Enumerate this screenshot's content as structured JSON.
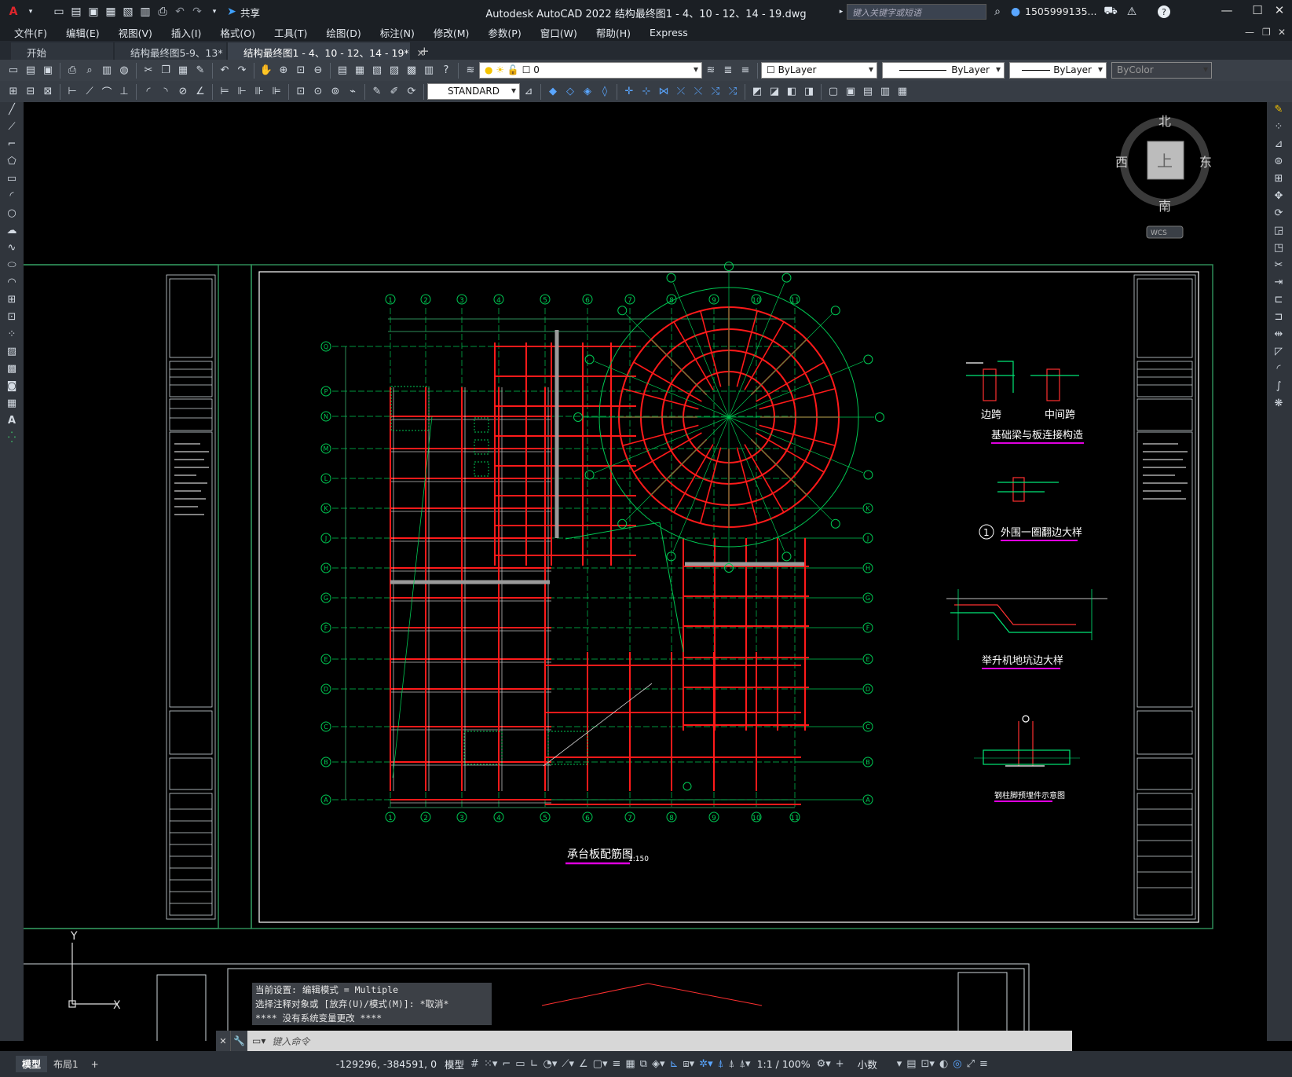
{
  "titlebar": {
    "app_logo": "A",
    "share_label": "共享",
    "title": "Autodesk AutoCAD 2022    结构最终图1 - 4、10 - 12、14 - 19.dwg",
    "search_placeholder": "键入关键字或短语",
    "user": "1505999135...",
    "help": "?"
  },
  "menu": [
    "文件(F)",
    "编辑(E)",
    "视图(V)",
    "插入(I)",
    "格式(O)",
    "工具(T)",
    "绘图(D)",
    "标注(N)",
    "修改(M)",
    "参数(P)",
    "窗口(W)",
    "帮助(H)",
    "Express"
  ],
  "tabs": [
    {
      "label": "开始",
      "closable": false,
      "active": false
    },
    {
      "label": "结构最终图5-9、13*",
      "closable": true,
      "active": false
    },
    {
      "label": "结构最终图1 - 4、10 - 12、14 - 19*",
      "closable": true,
      "active": true
    }
  ],
  "tab_close": "✕",
  "tab_add": "+",
  "toolbar": {
    "layer_value": "0",
    "color_value": "ByLayer",
    "linetype_value": "ByLayer",
    "lineweight_value": "ByLayer",
    "plotstyle_value": "ByColor",
    "textstyle_value": "STANDARD"
  },
  "viewcube": {
    "north": "北",
    "south": "南",
    "east": "东",
    "west": "西",
    "top": "上",
    "wcs": "WCS"
  },
  "drawing": {
    "main_title": "承台板配筋图",
    "scale": "1:150",
    "detail1_left": "边跨",
    "detail1_right": "中间跨",
    "detail1_title": "基础梁与板连接构造",
    "detail2_num": "1",
    "detail2_title": "外围一圈翻边大样",
    "detail3_title": "举升机地坑边大样",
    "detail4_title": "钢柱脚预埋件示意图",
    "grid_rows": [
      "Q",
      "P",
      "N",
      "M",
      "L",
      "K",
      "J",
      "H",
      "G",
      "F",
      "E",
      "D",
      "C",
      "B",
      "A"
    ],
    "grid_cols": [
      "1",
      "2",
      "3",
      "4",
      "5",
      "6",
      "7",
      "8",
      "9",
      "10",
      "11"
    ]
  },
  "ucs": {
    "y": "Y",
    "x": "X"
  },
  "command": {
    "history": [
      "当前设置: 编辑模式 = Multiple",
      "选择注释对象或 [放弃(U)/模式(M)]: *取消*",
      "**** 没有系统变量更改 ****"
    ],
    "placeholder": "键入命令"
  },
  "status": {
    "layout_tabs": [
      "模型",
      "布局1"
    ],
    "add": "+",
    "coords": "-129296, -384591, 0",
    "model": "模型",
    "scale": "1:1 / 100%",
    "units": "小数"
  },
  "colors": {
    "grid": "#00c853",
    "beam": "#ff1a1a",
    "frame": "#2e8b57",
    "text": "#ffffff",
    "accent": "#e000e0"
  }
}
